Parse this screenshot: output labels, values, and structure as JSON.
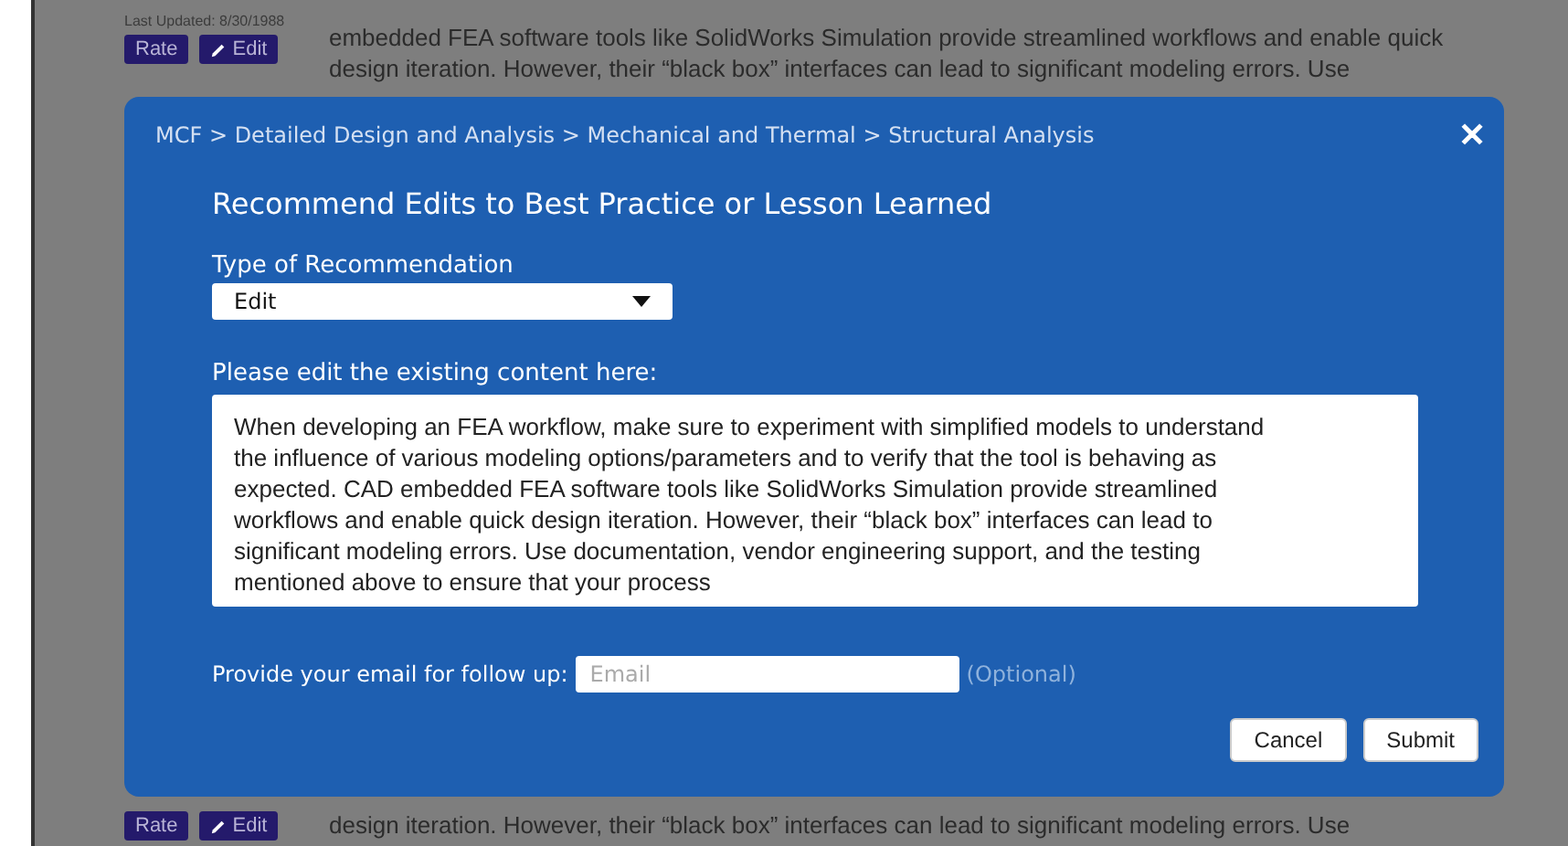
{
  "background": {
    "top": {
      "last_updated": "Last Updated: 8/30/1988",
      "buttons": [
        {
          "label": "Rate",
          "kind": "plain"
        },
        {
          "label": "Edit",
          "kind": "pencil"
        }
      ],
      "lines": [
        "embedded FEA software tools like SolidWorks Simulation provide streamlined workflows and enable quick",
        "design iteration. However, their “black box” interfaces can lead to significant modeling errors. Use"
      ]
    },
    "bottom": {
      "buttons": [
        {
          "label": "Rate",
          "kind": "plain"
        },
        {
          "label": "Edit",
          "kind": "pencil"
        }
      ],
      "lines": [
        "design iteration. However, their “black box” interfaces can lead to significant modeling errors. Use"
      ]
    }
  },
  "modal": {
    "breadcrumb": "MCF > Detailed Design and Analysis > Mechanical and Thermal > Structural Analysis",
    "close": "✕",
    "title": "Recommend Edits to Best Practice or Lesson Learned",
    "type_field": {
      "label": "Type of Recommendation",
      "value": "Edit"
    },
    "content_field": {
      "label": "Please edit the existing content here:",
      "value": "When developing an FEA workflow, make sure to experiment with simplified models to understand the influence of various modeling options/parameters and to verify that the tool is behaving as expected. CAD embedded FEA software tools like SolidWorks Simulation provide streamlined workflows and enable quick design iteration. However, their “black box” interfaces can lead to significant modeling errors. Use documentation, vendor engineering support, and the testing mentioned above to ensure that your process"
    },
    "email_field": {
      "label": "Provide your email for follow up:",
      "placeholder": "Email",
      "note": "(Optional)"
    },
    "buttons": [
      "Cancel",
      "Submit"
    ]
  }
}
